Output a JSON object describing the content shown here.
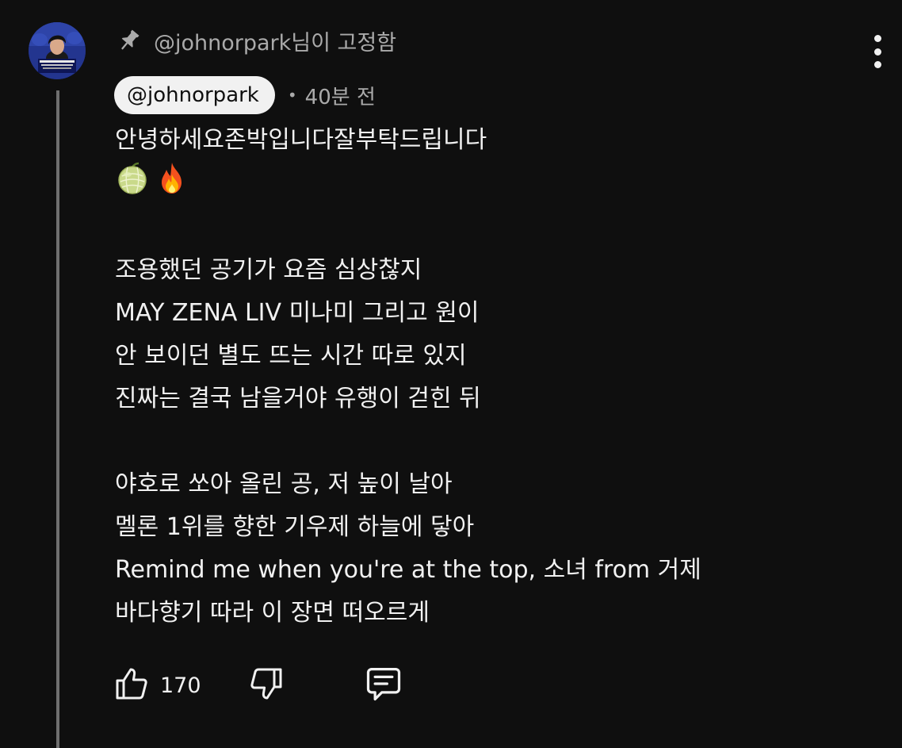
{
  "comment": {
    "pinned_text": "@johnorpark님이 고정함",
    "author": "@johnorpark",
    "separator": "•",
    "timestamp": "40분 전",
    "paragraphs": [
      [
        "안녕하세요존박입니다잘부탁드립니다"
      ],
      [
        "조용했던 공기가 요즘 심상찮지",
        "MAY ZENA LIV 미나미 그리고 원이",
        "안 보이던 별도 뜨는 시간 따로 있지",
        "진짜는 결국 남을거야 유행이 걷힌 뒤"
      ],
      [
        "야호로 쏘아 올린 공, 저 높이 날아",
        "멜론 1위를 향한 기우제 하늘에 닿아",
        "Remind me when you're at the top, 소녀 from 거제",
        "바다향기 따라 이 장면 떠오르게"
      ]
    ],
    "emojis": [
      "melon-icon",
      "fire-icon"
    ],
    "like_count": "170"
  },
  "icons": {
    "pin": "pin-icon",
    "more": "more-vert-icon",
    "like": "thumbs-up-icon",
    "dislike": "thumbs-down-icon",
    "reply": "comment-icon"
  },
  "colors": {
    "background": "#0f0f0f",
    "text": "#f1f1f1",
    "secondary_text": "#aaaaaa",
    "chip_background": "#f1f1f1",
    "thread_line": "#6f6f6f"
  }
}
